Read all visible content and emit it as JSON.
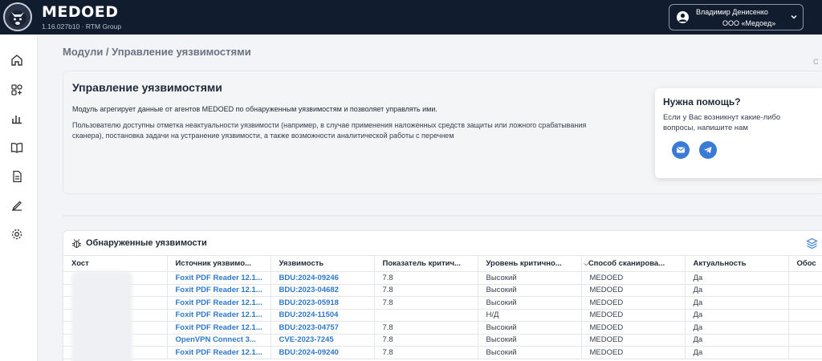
{
  "app": {
    "brand": "MEDOED",
    "version": "1.16.027b10 · RTM Group"
  },
  "user": {
    "name": "Владимир Денисенко",
    "org": "ООО «Медоед»"
  },
  "sidebar": {
    "items": [
      {
        "icon": "home-icon"
      },
      {
        "icon": "modules-icon"
      },
      {
        "icon": "chart-icon"
      },
      {
        "icon": "book-icon"
      },
      {
        "icon": "document-icon"
      },
      {
        "icon": "edit-icon"
      },
      {
        "icon": "gear-icon"
      }
    ]
  },
  "breadcrumb": "Модули / Управление уязвимостями",
  "corner_text": "С",
  "intro": {
    "title": "Управление уязвимостями",
    "p1": "Модуль агрегирует данные от агентов MEDOED по обнаруженным уязвимостям и позволяет управлять ими.",
    "p2": "Пользователю доступны отметка неактуальности уязвимости (например, в случае применения наложенных средств защиты или ложного срабатывания сканера), постановка задачи на устранение уязвимости, а также возможности аналитической работы с перечнем"
  },
  "help": {
    "title": "Нужна помощь?",
    "text": "Если у Вас возникнут какие-либо вопросы, напишите нам"
  },
  "vulns": {
    "title": "Обнаруженные уязвимости",
    "columns": [
      "Хост",
      "Источник уязвимо...",
      "Уязвимость",
      "Показатель критич...",
      "Уровень критично...",
      "Способ сканирова...",
      "Актуальность",
      "Обос"
    ],
    "rows": [
      [
        "",
        "Foxit PDF Reader 12.1...",
        "BDU:2024-09246",
        "7.8",
        "Высокий",
        "MEDOED",
        "Да",
        ""
      ],
      [
        "",
        "Foxit PDF Reader 12.1...",
        "BDU:2023-04682",
        "7.8",
        "Высокий",
        "MEDOED",
        "Да",
        ""
      ],
      [
        "",
        "Foxit PDF Reader 12.1...",
        "BDU:2023-05918",
        "7.8",
        "Высокий",
        "MEDOED",
        "Да",
        ""
      ],
      [
        "",
        "Foxit PDF Reader 12.1...",
        "BDU:2024-11504",
        "",
        "Н/Д",
        "MEDOED",
        "Да",
        ""
      ],
      [
        "",
        "Foxit PDF Reader 12.1...",
        "BDU:2023-04757",
        "7.8",
        "Высокий",
        "MEDOED",
        "Да",
        ""
      ],
      [
        "",
        "OpenVPN Connect 3...",
        "CVE-2023-7245",
        "7.8",
        "Высокий",
        "MEDOED",
        "Да",
        ""
      ],
      [
        "",
        "Foxit PDF Reader 12.1...",
        "BDU:2024-09240",
        "7.8",
        "Высокий",
        "MEDOED",
        "Да",
        ""
      ]
    ]
  },
  "colors": {
    "topbar": "#111c2e",
    "link": "#2e78c9",
    "accent": "#3a7bd5"
  }
}
